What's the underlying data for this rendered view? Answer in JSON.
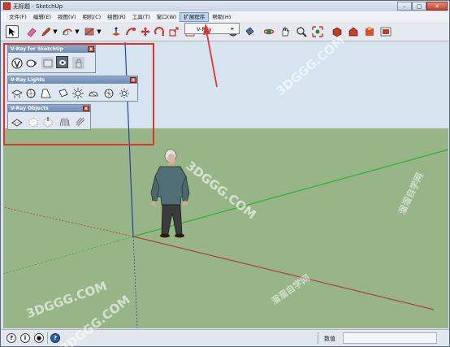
{
  "window": {
    "title": "无标题 - SketchUp",
    "minimize": "–",
    "maximize": "□",
    "close": "✕"
  },
  "menubar": {
    "items": [
      {
        "label": "文件(F)"
      },
      {
        "label": "编辑(E)"
      },
      {
        "label": "视图(V)"
      },
      {
        "label": "相机(C)"
      },
      {
        "label": "绘图(R)"
      },
      {
        "label": "工具(T)"
      },
      {
        "label": "窗口(W)"
      },
      {
        "label": "扩展程序"
      },
      {
        "label": "帮助(H)"
      }
    ],
    "active_index": 7
  },
  "extensions_menu": {
    "items": [
      {
        "label": "V-Ray",
        "arrow": "▸"
      }
    ]
  },
  "toolbar": {
    "tools": [
      "select-icon",
      "eraser-icon",
      "pencil-icon",
      "dropdown-arrow-icon",
      "shape-icon",
      "dropdown-arrow-icon",
      "rectangle-icon",
      "dropdown-arrow-icon",
      "push-pull-icon",
      "follow-me-icon",
      "move-icon",
      "rotate-icon",
      "scale-icon",
      "offset-icon",
      "tape-measure-icon",
      "orbit-icon",
      "pan-icon",
      "zoom-icon",
      "zoom-extents-icon",
      "components-icon",
      "warehouse-icon",
      "extension-warehouse-icon",
      "layout-icon"
    ]
  },
  "floating_toolbars": {
    "vray_sketchup": {
      "title": "V-Ray for SketchUp",
      "close": "x"
    },
    "vray_lights": {
      "title": "V-Ray Lights",
      "close": "x"
    },
    "vray_objects": {
      "title": "V-Ray Objects",
      "close": "x"
    }
  },
  "statusbar": {
    "measure_label": "数值",
    "measure_value": ""
  },
  "watermarks": {
    "w1": "3DGGG.COM",
    "w2": "3DGGG.COM",
    "w3": "3DGGG.COM",
    "w4": "3DGGG.COM",
    "w5": "溜溜自学网",
    "w6": "溜溜自学网"
  },
  "colors": {
    "sky": "#d5e4ee",
    "ground": "#98b587",
    "highlight": "#e0342a",
    "red_axis": "#b0413a",
    "green_axis": "#2fb232",
    "blue_axis": "#2a3ea8"
  }
}
